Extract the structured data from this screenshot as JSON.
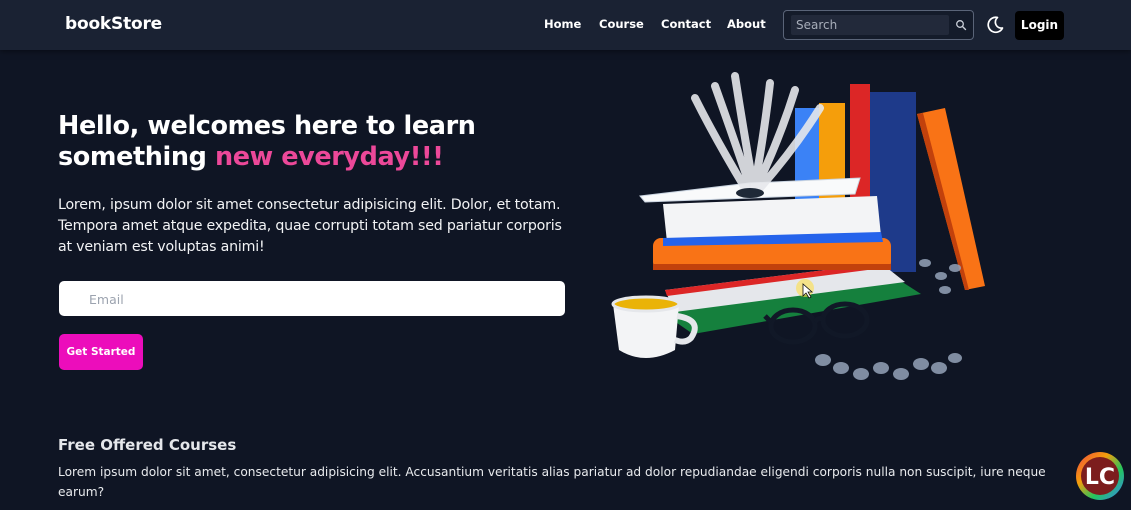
{
  "header": {
    "brand": "bookStore",
    "nav": [
      {
        "label": "Home"
      },
      {
        "label": "Course"
      },
      {
        "label": "Contact"
      },
      {
        "label": "About"
      }
    ],
    "search": {
      "placeholder": "Search",
      "icon": "search-icon"
    },
    "theme_icon": "moon-icon",
    "login_label": "Login"
  },
  "hero": {
    "title_part1": "Hello, welcomes here to learn something ",
    "title_highlight": "new everyday!!!",
    "description": "Lorem, ipsum dolor sit amet consectetur adipisicing elit. Dolor, et totam. Tempora amet atque expedita, quae corrupti totam sed pariatur corporis at veniam est voluptas animi!",
    "email_placeholder": "Email",
    "cta_label": "Get Started"
  },
  "courses": {
    "title": "Free Offered Courses",
    "description": "Lorem ipsum dolor sit amet, consectetur adipisicing elit. Accusantium veritatis alias pariatur ad dolor repudiandae eligendi corporis nulla non suscipit, iure neque earum?"
  },
  "corner_logo": {
    "text": "LC"
  },
  "colors": {
    "background": "#0f1524",
    "navbar": "#1a2233",
    "accent_pink": "#ec4899",
    "button_magenta": "#ec0dbb"
  }
}
